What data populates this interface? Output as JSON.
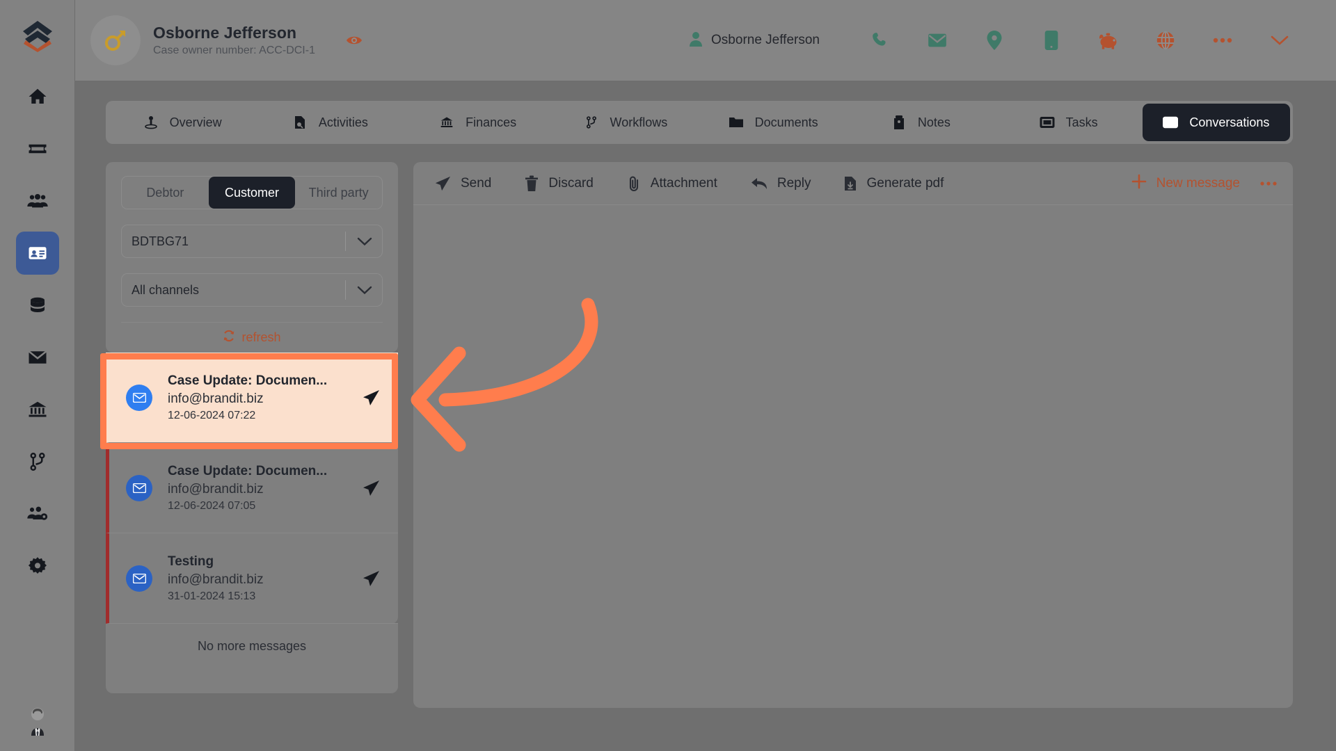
{
  "colors": {
    "accent_orange": "#ff7d4d",
    "brand_red": "#b4522f",
    "active_dark": "#1c2029",
    "sidebar_active": "#3d5a96",
    "badge_blue": "#2b62c4",
    "selected_row_bg": "#fbe0cd",
    "unread_bar": "#a02c2c",
    "teal_icon": "#3f7a68",
    "backdrop": "#6f6f6f"
  },
  "rail": {
    "logo_name": "app-logo",
    "items": [
      {
        "icon": "home-icon",
        "name": "sidebar-item-home",
        "active": false
      },
      {
        "icon": "card-icon",
        "name": "sidebar-item-cases",
        "active": false
      },
      {
        "icon": "people-icon",
        "name": "sidebar-item-customers",
        "active": false
      },
      {
        "icon": "id-card-icon",
        "name": "sidebar-item-debtors",
        "active": true
      },
      {
        "icon": "database-icon",
        "name": "sidebar-item-data",
        "active": false
      },
      {
        "icon": "envelope-icon",
        "name": "sidebar-item-mail",
        "active": false
      },
      {
        "icon": "bank-icon",
        "name": "sidebar-item-finances",
        "active": false
      },
      {
        "icon": "workflow-icon",
        "name": "sidebar-item-workflows",
        "active": false
      },
      {
        "icon": "user-cog-icon",
        "name": "sidebar-item-user-management",
        "active": false
      },
      {
        "icon": "gear-icon",
        "name": "sidebar-item-settings",
        "active": false
      }
    ],
    "avatar_name": "user-avatar"
  },
  "header": {
    "person_name": "Osborne Jefferson",
    "case_owner_line": "Case owner number: ACC-DCI-1",
    "gender_icon": "male-symbol-icon",
    "eye_icon": "eye-icon",
    "user_name": "Osborne Jefferson",
    "user_icon": "person-icon",
    "actions": [
      {
        "icon": "phone-icon",
        "name": "call-action",
        "color": "#3f7a68"
      },
      {
        "icon": "envelope-icon",
        "name": "email-action",
        "color": "#3f7a68"
      },
      {
        "icon": "location-pin-icon",
        "name": "address-action",
        "color": "#3f7a68"
      },
      {
        "icon": "mobile-icon",
        "name": "mobile-action",
        "color": "#3f7a68"
      },
      {
        "icon": "piggy-bank-icon",
        "name": "finance-action",
        "color": "#b4522f"
      },
      {
        "icon": "globe-icon",
        "name": "web-action",
        "color": "#b4522f"
      },
      {
        "icon": "ellipsis-icon",
        "name": "more-actions",
        "color": "#b4522f"
      },
      {
        "icon": "chevron-down-icon",
        "name": "expand-header",
        "color": "#b4522f"
      }
    ]
  },
  "tabs": [
    {
      "label": "Overview",
      "icon": "overview-icon",
      "active": false
    },
    {
      "label": "Activities",
      "icon": "activities-icon",
      "active": false
    },
    {
      "label": "Finances",
      "icon": "bank-icon",
      "active": false
    },
    {
      "label": "Workflows",
      "icon": "workflow-icon",
      "active": false
    },
    {
      "label": "Documents",
      "icon": "folder-icon",
      "active": false
    },
    {
      "label": "Notes",
      "icon": "note-icon",
      "active": false
    },
    {
      "label": "Tasks",
      "icon": "tasks-icon",
      "active": false
    },
    {
      "label": "Conversations",
      "icon": "envelope-icon",
      "active": true
    }
  ],
  "left_panel": {
    "segments": [
      {
        "label": "Debtor",
        "active": false
      },
      {
        "label": "Customer",
        "active": true
      },
      {
        "label": "Third party",
        "active": false
      }
    ],
    "case_select": {
      "value": "BDTBG71",
      "chevron": "chevron-down-icon"
    },
    "channel_select": {
      "value": "All channels",
      "chevron": "chevron-down-icon"
    },
    "refresh_label": "refresh",
    "refresh_icon": "refresh-icon",
    "messages": [
      {
        "subject": "Case Update: Documen...",
        "from": "info@brandit.biz",
        "date": "12-06-2024 07:22",
        "selected": true,
        "badge_icon": "envelope-icon",
        "send_icon": "paper-plane-icon"
      },
      {
        "subject": "Case Update: Documen...",
        "from": "info@brandit.biz",
        "date": "12-06-2024 07:05",
        "selected": false,
        "badge_icon": "envelope-icon",
        "send_icon": "paper-plane-icon"
      },
      {
        "subject": "Testing",
        "from": "info@brandit.biz",
        "date": "31-01-2024 15:13",
        "selected": false,
        "badge_icon": "envelope-icon",
        "send_icon": "paper-plane-icon"
      }
    ],
    "no_more_messages": "No more messages"
  },
  "right_panel": {
    "toolbar": [
      {
        "label": "Send",
        "icon": "paper-plane-icon"
      },
      {
        "label": "Discard",
        "icon": "trash-icon"
      },
      {
        "label": "Attachment",
        "icon": "paperclip-icon"
      },
      {
        "label": "Reply",
        "icon": "reply-arrow-icon"
      },
      {
        "label": "Generate pdf",
        "icon": "file-download-icon"
      }
    ],
    "new_message_label": "New message",
    "new_message_icon": "plus-icon",
    "more_icon": "ellipsis-icon",
    "body_text": ""
  },
  "annotation": {
    "arrow_color": "#ff7d4d",
    "highlight_color": "#ff7d4d",
    "arrow_name": "pointer-arrow",
    "highlight_name": "selected-message-highlight"
  }
}
